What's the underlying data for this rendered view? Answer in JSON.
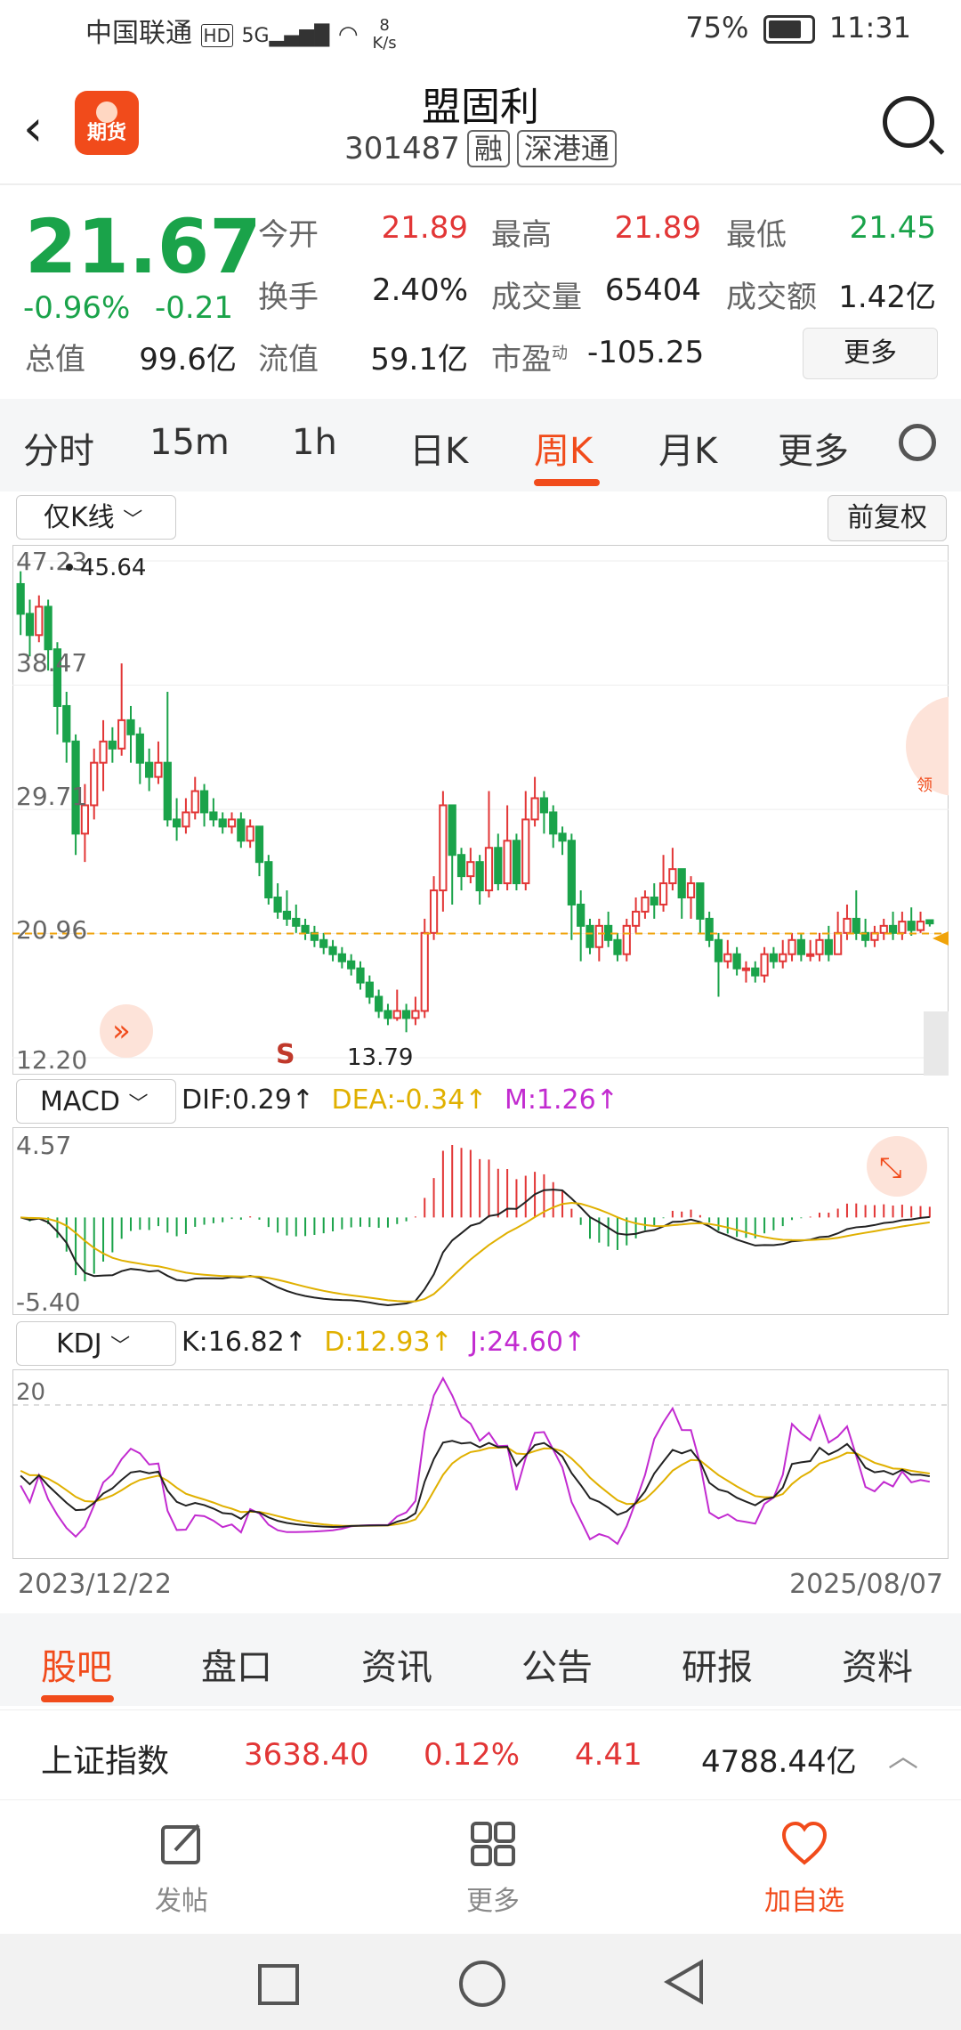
{
  "status": {
    "carrier": "中国联通",
    "net": "HD 5G",
    "speed": "8 K/s",
    "battery": "75%",
    "time": "11:31"
  },
  "header": {
    "title": "盟固利",
    "code": "301487",
    "tags": [
      "融",
      "深港通"
    ],
    "logo_text": "期货"
  },
  "quote": {
    "price": "21.67",
    "change_pct": "-0.96%",
    "change": "-0.21",
    "rows": [
      [
        {
          "label": "今开",
          "value": "21.89",
          "color": "red"
        },
        {
          "label": "最高",
          "value": "21.89",
          "color": "red"
        },
        {
          "label": "最低",
          "value": "21.45",
          "color": "green"
        }
      ],
      [
        {
          "label": "换手",
          "value": "2.40%",
          "color": "black"
        },
        {
          "label": "成交量",
          "value": "65404",
          "color": "black"
        },
        {
          "label": "成交额",
          "value": "1.42亿",
          "color": "black"
        }
      ]
    ],
    "row3": {
      "total_label": "总值",
      "total_value": "99.6亿",
      "float_label": "流值",
      "float_value": "59.1亿",
      "pe_label": "市盈",
      "pe_sup": "动",
      "pe_value": "-105.25",
      "more": "更多"
    }
  },
  "tabs": [
    "分时",
    "15m",
    "1h",
    "日K",
    "周K",
    "月K",
    "更多"
  ],
  "active_tab": "周K",
  "kline": {
    "mode": "仅K线",
    "adjust": "前复权",
    "y_ticks": [
      "47.23",
      "38.47",
      "29.71",
      "20.96",
      "12.20"
    ],
    "max_label": "45.64",
    "min_label": "13.79",
    "signal": "S",
    "dashed_price": 20.96
  },
  "macd": {
    "name": "MACD",
    "dif": "DIF:0.29↑",
    "dea": "DEA:-0.34↑",
    "m": "M:1.26↑",
    "y_top": "4.57",
    "y_bottom": "-5.40"
  },
  "kdj": {
    "name": "KDJ",
    "k": "K:16.82↑",
    "d": "D:12.93↑",
    "j": "J:24.60↑",
    "level": "20"
  },
  "dates": {
    "start": "2023/12/22",
    "end": "2025/08/07"
  },
  "chart_data": {
    "type": "candlestick",
    "period": "周K",
    "y_range": [
      12.2,
      47.23
    ],
    "candles": [
      [
        45.6,
        43.5,
        46.5,
        42.0
      ],
      [
        43.5,
        42.0,
        44.5,
        40.5
      ],
      [
        42.0,
        44.0,
        44.8,
        41.5
      ],
      [
        44.0,
        41.0,
        44.5,
        39.5
      ],
      [
        41.0,
        37.0,
        41.5,
        35.0
      ],
      [
        37.0,
        34.5,
        38.0,
        33.0
      ],
      [
        34.5,
        28.0,
        35.0,
        26.5
      ],
      [
        28.0,
        30.0,
        31.5,
        26.0
      ],
      [
        30.0,
        33.0,
        34.0,
        29.0
      ],
      [
        33.0,
        34.5,
        36.0,
        31.0
      ],
      [
        34.5,
        34.0,
        35.5,
        33.0
      ],
      [
        34.0,
        36.0,
        40.0,
        33.5
      ],
      [
        36.0,
        35.0,
        37.0,
        33.0
      ],
      [
        35.0,
        33.0,
        35.5,
        31.5
      ],
      [
        33.0,
        32.0,
        34.0,
        31.0
      ],
      [
        32.0,
        33.0,
        34.5,
        31.5
      ],
      [
        33.0,
        29.0,
        38.0,
        28.5
      ],
      [
        29.0,
        28.5,
        30.5,
        27.5
      ],
      [
        28.5,
        29.5,
        30.5,
        28.0
      ],
      [
        29.5,
        31.0,
        32.0,
        29.0
      ],
      [
        31.0,
        29.5,
        31.5,
        28.5
      ],
      [
        29.5,
        29.0,
        30.5,
        28.5
      ],
      [
        29.0,
        28.5,
        29.5,
        28.0
      ],
      [
        28.5,
        29.0,
        29.5,
        28.0
      ],
      [
        29.0,
        27.5,
        29.5,
        27.0
      ],
      [
        27.5,
        28.5,
        29.0,
        27.0
      ],
      [
        28.5,
        26.0,
        28.5,
        25.0
      ],
      [
        26.0,
        23.5,
        26.5,
        23.0
      ],
      [
        23.5,
        22.5,
        24.5,
        22.0
      ],
      [
        22.5,
        22.0,
        24.0,
        21.5
      ],
      [
        22.0,
        21.5,
        23.0,
        21.0
      ],
      [
        21.5,
        21.0,
        22.0,
        20.5
      ],
      [
        21.0,
        20.5,
        21.5,
        20.0
      ],
      [
        20.5,
        20.0,
        21.0,
        19.5
      ],
      [
        20.0,
        19.5,
        20.5,
        19.0
      ],
      [
        19.5,
        19.0,
        20.0,
        18.5
      ],
      [
        19.0,
        18.5,
        19.5,
        18.0
      ],
      [
        18.5,
        17.5,
        19.0,
        17.0
      ],
      [
        17.5,
        16.5,
        18.0,
        16.0
      ],
      [
        16.5,
        15.5,
        17.0,
        15.0
      ],
      [
        15.5,
        15.0,
        16.0,
        14.5
      ],
      [
        15.0,
        15.5,
        17.0,
        14.8
      ],
      [
        15.5,
        15.0,
        16.0,
        14.0
      ],
      [
        15.0,
        15.5,
        16.5,
        14.5
      ],
      [
        15.5,
        21.0,
        22.0,
        15.0
      ],
      [
        21.0,
        24.0,
        25.0,
        20.5
      ],
      [
        24.0,
        30.0,
        31.0,
        22.5
      ],
      [
        30.0,
        26.5,
        30.0,
        23.0
      ],
      [
        26.5,
        25.0,
        27.0,
        24.0
      ],
      [
        25.0,
        26.0,
        27.0,
        24.5
      ],
      [
        26.0,
        24.0,
        26.5,
        23.0
      ],
      [
        24.0,
        27.0,
        31.0,
        23.5
      ],
      [
        27.0,
        24.5,
        28.0,
        24.0
      ],
      [
        24.5,
        27.5,
        30.0,
        24.0
      ],
      [
        27.5,
        24.5,
        28.0,
        24.0
      ],
      [
        24.5,
        29.0,
        31.0,
        24.0
      ],
      [
        29.0,
        30.5,
        32.0,
        28.5
      ],
      [
        30.5,
        29.5,
        31.0,
        28.0
      ],
      [
        29.5,
        28.0,
        30.0,
        27.0
      ],
      [
        28.0,
        27.5,
        28.5,
        26.5
      ],
      [
        27.5,
        23.0,
        28.0,
        20.5
      ],
      [
        23.0,
        21.5,
        24.0,
        19.0
      ],
      [
        21.5,
        20.0,
        22.0,
        19.5
      ],
      [
        20.0,
        21.5,
        22.0,
        19.0
      ],
      [
        21.5,
        20.5,
        22.5,
        20.0
      ],
      [
        20.5,
        19.5,
        21.0,
        19.0
      ],
      [
        19.5,
        21.5,
        22.0,
        19.0
      ],
      [
        21.5,
        22.5,
        23.5,
        21.0
      ],
      [
        22.5,
        23.5,
        24.0,
        22.0
      ],
      [
        23.5,
        23.0,
        24.5,
        22.0
      ],
      [
        23.0,
        24.5,
        26.5,
        22.5
      ],
      [
        24.5,
        25.5,
        27.0,
        24.0
      ],
      [
        25.5,
        23.5,
        25.5,
        22.0
      ],
      [
        23.5,
        24.5,
        25.0,
        22.0
      ],
      [
        24.5,
        22.0,
        24.5,
        21.0
      ],
      [
        22.0,
        20.5,
        22.5,
        20.0
      ],
      [
        20.5,
        19.0,
        21.0,
        16.5
      ],
      [
        19.0,
        19.5,
        20.5,
        18.5
      ],
      [
        19.5,
        18.5,
        20.0,
        18.0
      ],
      [
        18.5,
        18.5,
        19.0,
        17.5
      ],
      [
        18.5,
        18.0,
        19.0,
        17.5
      ],
      [
        18.0,
        19.5,
        20.0,
        17.5
      ],
      [
        19.5,
        19.0,
        20.0,
        18.5
      ],
      [
        19.0,
        19.5,
        20.5,
        18.5
      ],
      [
        19.5,
        20.5,
        21.0,
        19.0
      ],
      [
        20.5,
        19.5,
        21.0,
        19.0
      ],
      [
        19.5,
        19.5,
        20.5,
        19.0
      ],
      [
        19.5,
        20.5,
        21.0,
        19.0
      ],
      [
        20.5,
        19.5,
        21.5,
        19.0
      ],
      [
        19.5,
        21.0,
        22.5,
        19.5
      ],
      [
        21.0,
        22.0,
        23.0,
        20.5
      ],
      [
        22.0,
        21.0,
        24.0,
        20.5
      ],
      [
        21.0,
        20.5,
        22.0,
        20.0
      ],
      [
        20.5,
        21.0,
        21.5,
        20.0
      ],
      [
        21.0,
        21.5,
        22.0,
        20.5
      ],
      [
        21.5,
        21.0,
        22.5,
        20.5
      ],
      [
        21.0,
        21.8,
        22.5,
        20.5
      ],
      [
        21.8,
        21.2,
        22.8,
        20.8
      ],
      [
        21.2,
        21.8,
        22.5,
        21.0
      ],
      [
        21.9,
        21.67,
        21.89,
        21.45
      ]
    ]
  }
}
